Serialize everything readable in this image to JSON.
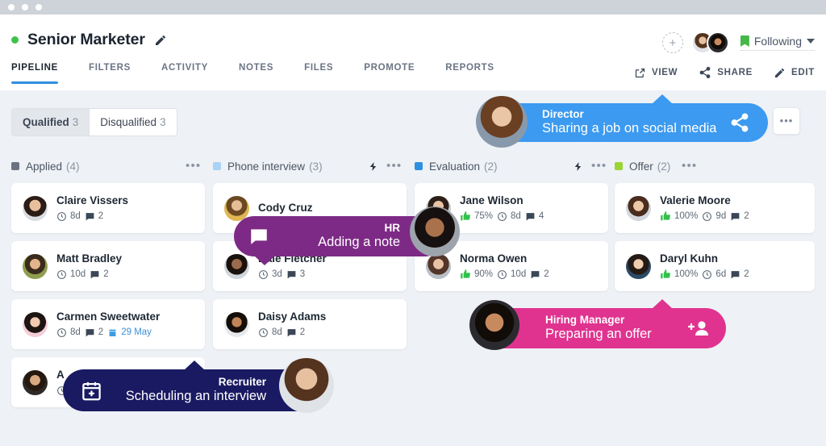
{
  "window": {
    "dots": [
      "close",
      "minimize",
      "maximize"
    ]
  },
  "header": {
    "job_title": "Senior Marketer",
    "status_dot_color": "#3fc24c",
    "edit_pencil": "pencil-icon",
    "nav": [
      {
        "label": "PIPELINE",
        "active": true
      },
      {
        "label": "FILTERS",
        "active": false
      },
      {
        "label": "ACTIVITY",
        "active": false
      },
      {
        "label": "NOTES",
        "active": false
      },
      {
        "label": "FILES",
        "active": false
      },
      {
        "label": "PROMOTE",
        "active": false
      },
      {
        "label": "REPORTS",
        "active": false
      }
    ],
    "add_person_label": "+",
    "following_label": "Following",
    "actions": [
      {
        "label": "VIEW",
        "icon": "external-link-icon"
      },
      {
        "label": "SHARE",
        "icon": "share-icon"
      },
      {
        "label": "EDIT",
        "icon": "pencil-icon"
      }
    ]
  },
  "filter_tabs": [
    {
      "label": "Qualified",
      "count": "3",
      "active": true
    },
    {
      "label": "Disqualified",
      "count": "3",
      "active": false
    }
  ],
  "columns": [
    {
      "label": "Applied",
      "count": "(4)",
      "color": "#6b7382",
      "bolt": false,
      "cards": [
        {
          "name": "Claire Vissers",
          "days": "8d",
          "comments": "2",
          "score": null,
          "date": null,
          "face": "f1"
        },
        {
          "name": "Matt Bradley",
          "days": "10d",
          "comments": "2",
          "score": null,
          "date": null,
          "face": "f2"
        },
        {
          "name": "Carmen Sweetwater",
          "days": "8d",
          "comments": "2",
          "score": null,
          "date": "29 May",
          "face": "f3"
        },
        {
          "name": "A",
          "days": "",
          "comments": "",
          "score": null,
          "date": null,
          "face": "f4"
        }
      ]
    },
    {
      "label": "Phone interview",
      "count": "(3)",
      "color": "#a8d3f5",
      "bolt": true,
      "cards": [
        {
          "name": "Cody Cruz",
          "days": "",
          "comments": "",
          "score": null,
          "date": null,
          "face": "f5"
        },
        {
          "name": "Dale Fletcher",
          "days": "3d",
          "comments": "3",
          "score": null,
          "date": null,
          "face": "f6"
        },
        {
          "name": "Daisy Adams",
          "days": "8d",
          "comments": "2",
          "score": null,
          "date": null,
          "face": "f7"
        }
      ]
    },
    {
      "label": "Evaluation",
      "count": "(2)",
      "color": "#2f8fe0",
      "bolt": true,
      "cards": [
        {
          "name": "Jane Wilson",
          "days": "8d",
          "comments": "4",
          "score": "75%",
          "date": null,
          "face": "f8"
        },
        {
          "name": "Norma Owen",
          "days": "10d",
          "comments": "2",
          "score": "90%",
          "date": null,
          "face": "f9"
        }
      ]
    },
    {
      "label": "Offer",
      "count": "(2)",
      "color": "#9bd435",
      "bolt": false,
      "cards": [
        {
          "name": "Valerie Moore",
          "days": "9d",
          "comments": "2",
          "score": "100%",
          "date": null,
          "face": "f10"
        },
        {
          "name": "Daryl Kuhn",
          "days": "6d",
          "comments": "2",
          "score": "100%",
          "date": null,
          "face": "f11"
        }
      ]
    }
  ],
  "callouts": [
    {
      "id": "director",
      "role": "Director",
      "action": "Sharing a job on social media",
      "color": "#3c9af0",
      "icon": "share-icon"
    },
    {
      "id": "hr",
      "role": "HR",
      "action": "Adding a note",
      "color": "#7d2a86",
      "icon": "comment-icon"
    },
    {
      "id": "hiring-manager",
      "role": "Hiring Manager",
      "action": "Preparing an offer",
      "color": "#e0338f",
      "icon": "add-user-icon"
    },
    {
      "id": "recruiter",
      "role": "Recruiter",
      "action": "Scheduling an interview",
      "color": "#1a1a63",
      "icon": "calendar-add-icon"
    }
  ],
  "more_button": {
    "label": "•••"
  }
}
